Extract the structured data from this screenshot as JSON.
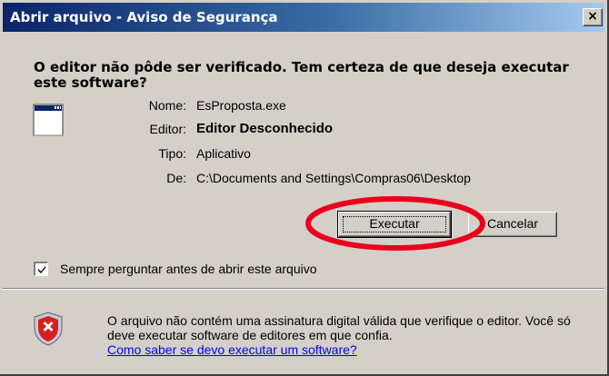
{
  "window": {
    "title": "Abrir arquivo - Aviso de Segurança",
    "close_glyph": "×"
  },
  "heading": "O editor não pôde ser verificado.  Tem certeza de que deseja executar este software?",
  "file_icon": "application-window-icon",
  "fields": {
    "name_label": "Nome:",
    "name_value": "EsProposta.exe",
    "publisher_label": "Editor:",
    "publisher_value": "Editor Desconhecido",
    "type_label": "Tipo:",
    "type_value": "Aplicativo",
    "from_label": "De:",
    "from_value": "C:\\Documents and Settings\\Compras06\\Desktop"
  },
  "buttons": {
    "run": "Executar",
    "cancel": "Cancelar"
  },
  "annotation": {
    "shape": "red-ellipse",
    "color": "#e8001c"
  },
  "checkbox": {
    "label": "Sempre perguntar antes de abrir este arquivo",
    "checked": true
  },
  "warning": {
    "icon": "shield-x-icon",
    "text": "O arquivo não contém uma assinatura digital válida que verifique o editor.  Você só deve executar software de editores em que confia.",
    "link": "Como saber se devo executar um software?"
  },
  "colors": {
    "title_bar_start": "#0a246a",
    "title_bar_end": "#a6caf0",
    "dialog_bg": "#d4d0c8",
    "link": "#0000ff",
    "shield_red": "#d42020"
  }
}
